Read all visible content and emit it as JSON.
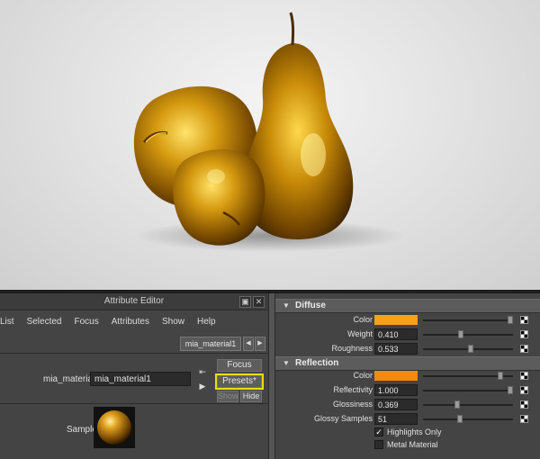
{
  "viewport": {
    "icons": [
      "golden-pear-render",
      "golden-apple-render",
      "small-golden-apple-render"
    ]
  },
  "attribute_editor": {
    "title": "Attribute Editor",
    "window_icons": [
      "float-icon",
      "close-icon"
    ],
    "menu": [
      "List",
      "Selected",
      "Focus",
      "Attributes",
      "Show",
      "Help"
    ],
    "node_tab": "mia_material1",
    "material_label": "mia_material:",
    "material_name": "mia_material1",
    "buttons": {
      "focus": "Focus",
      "presets": "Presets*",
      "show": "Show",
      "hide": "Hide"
    },
    "sample_label": "Sample",
    "colors": {
      "highlight": "#e8e000"
    }
  },
  "diffuse": {
    "title": "Diffuse",
    "color_label": "Color",
    "color_value": "#f5a11a",
    "weight_label": "Weight",
    "weight": "0.410",
    "weight_fraction": 0.41,
    "roughness_label": "Roughness",
    "roughness": "0.533",
    "roughness_fraction": 0.533
  },
  "reflection": {
    "title": "Reflection",
    "color_label": "Color",
    "color_value": "#f08a12",
    "reflectivity_label": "Reflectivity",
    "reflectivity": "1.000",
    "reflectivity_fraction": 1.0,
    "glossiness_label": "Glossiness",
    "glossiness": "0.369",
    "glossiness_fraction": 0.369,
    "glossy_samples_label": "Glossy Samples",
    "glossy_samples": "51",
    "glossy_samples_fraction": 0.4,
    "highlights_only_label": "Highlights Only",
    "highlights_only": true,
    "metal_material_label": "Metal Material",
    "metal_material": false
  }
}
